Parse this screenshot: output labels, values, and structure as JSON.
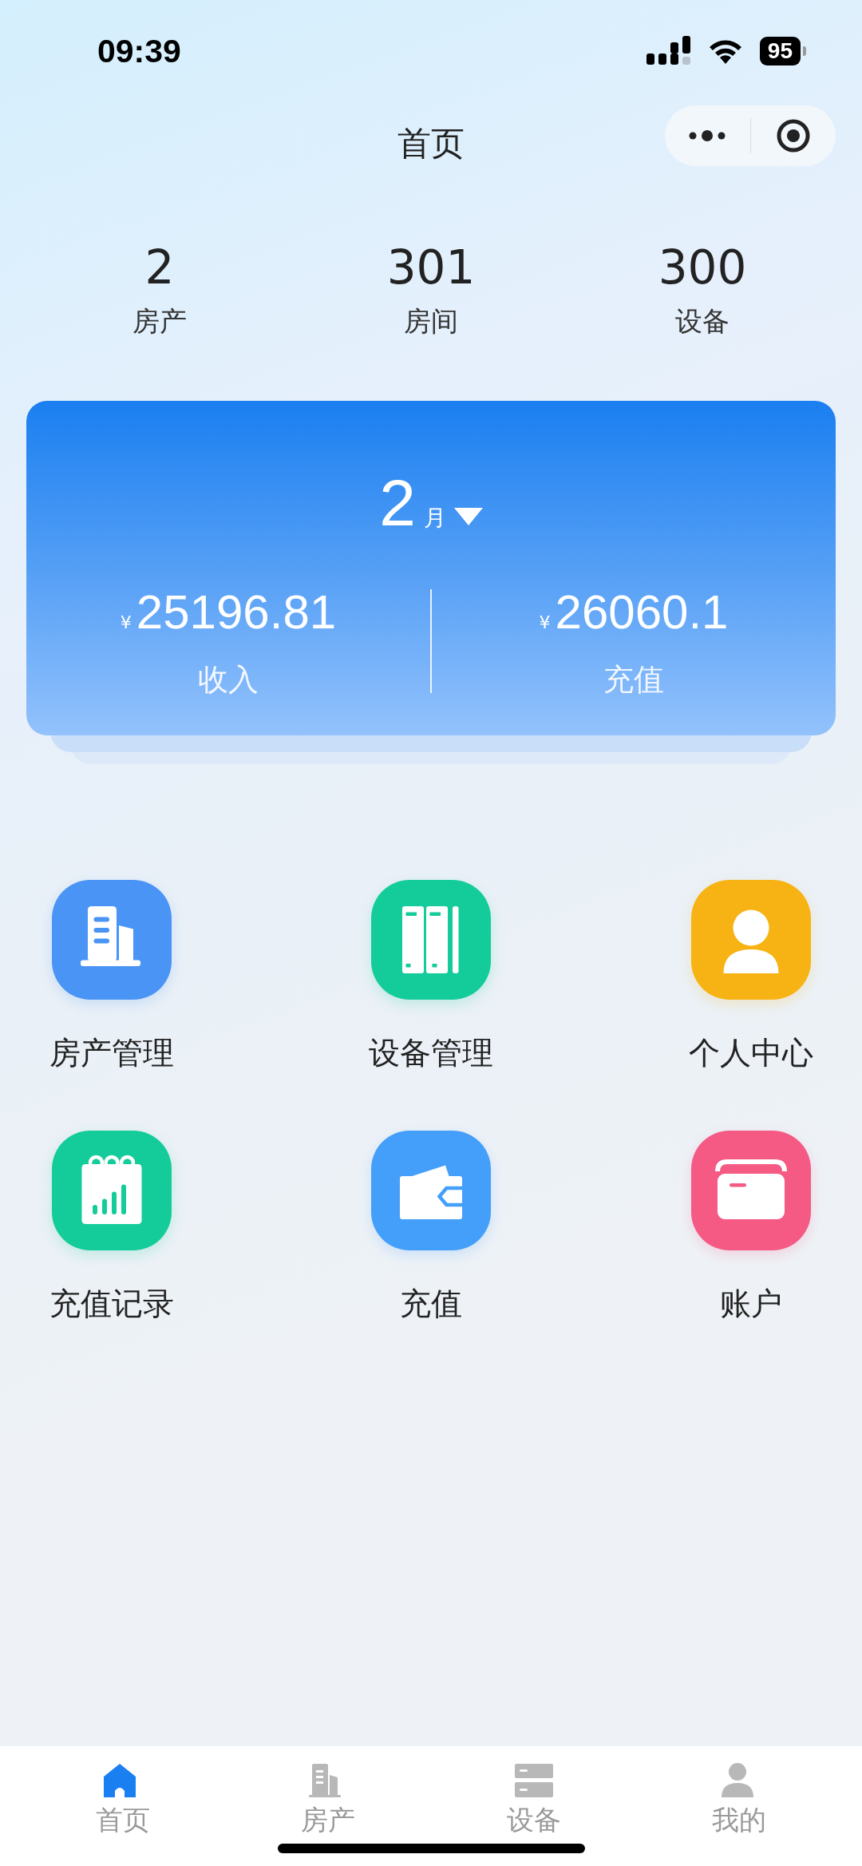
{
  "status_bar": {
    "time": "09:39",
    "battery": "95"
  },
  "header": {
    "title": "首页"
  },
  "stats": [
    {
      "value": "2",
      "label": "房产"
    },
    {
      "value": "301",
      "label": "房间"
    },
    {
      "value": "300",
      "label": "设备"
    }
  ],
  "summary": {
    "month": "2",
    "month_unit": "月",
    "items": [
      {
        "currency": "¥",
        "amount": "25196.81",
        "label": "收入"
      },
      {
        "currency": "¥",
        "amount": "26060.1",
        "label": "充值"
      }
    ]
  },
  "menu": [
    {
      "label": "房产管理",
      "kind": "building",
      "color": "#4a94f5"
    },
    {
      "label": "设备管理",
      "kind": "cabinet",
      "color": "#14cc9a"
    },
    {
      "label": "个人中心",
      "kind": "person",
      "color": "#f7b314"
    },
    {
      "label": "充值记录",
      "kind": "calendar",
      "color": "#14cc9a"
    },
    {
      "label": "充值",
      "kind": "wallet",
      "color": "#449ffa"
    },
    {
      "label": "账户",
      "kind": "folder",
      "color": "#f45a83"
    }
  ],
  "tabs": [
    {
      "label": "首页",
      "kind": "home",
      "selected": true
    },
    {
      "label": "房产",
      "kind": "building",
      "selected": false
    },
    {
      "label": "设备",
      "kind": "server",
      "selected": false
    },
    {
      "label": "我的",
      "kind": "person",
      "selected": false
    }
  ]
}
